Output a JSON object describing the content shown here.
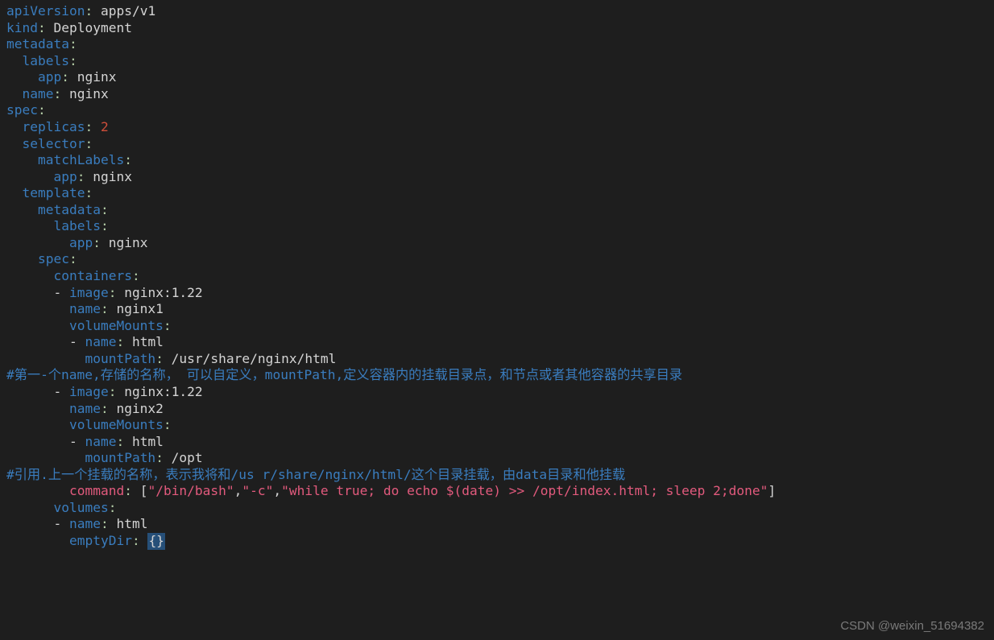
{
  "l1": {
    "k": "apiVersion",
    "c": ":",
    "v": " apps/v1"
  },
  "l2": {
    "k": "kind",
    "c": ":",
    "v": " Deployment"
  },
  "l3": {
    "k": "metadata",
    "c": ":"
  },
  "l4": {
    "k": "labels",
    "c": ":"
  },
  "l5": {
    "k": "app",
    "c": ":",
    "v": " nginx"
  },
  "l6": {
    "k": "name",
    "c": ":",
    "v": " nginx"
  },
  "l7": {
    "k": "spec",
    "c": ":"
  },
  "l8": {
    "k": "replicas",
    "c": ":",
    "sp": " ",
    "v": "2"
  },
  "l9": {
    "k": "selector",
    "c": ":"
  },
  "l10": {
    "k": "matchLabels",
    "c": ":"
  },
  "l11": {
    "k": "app",
    "c": ":",
    "v": " nginx"
  },
  "l12": {
    "k": "template",
    "c": ":"
  },
  "l13": {
    "k": "metadata",
    "c": ":"
  },
  "l14": {
    "k": "labels",
    "c": ":"
  },
  "l15": {
    "k": "app",
    "c": ":",
    "v": " nginx"
  },
  "l16": {
    "k": "spec",
    "c": ":"
  },
  "l17": {
    "k": "containers",
    "c": ":"
  },
  "l18": {
    "dash": "- ",
    "k": "image",
    "c": ":",
    "v": " nginx:1.22"
  },
  "l19": {
    "k": "name",
    "c": ":",
    "v": " nginx1"
  },
  "l20": {
    "k": "volumeMounts",
    "c": ":"
  },
  "l21": {
    "dash": "- ",
    "k": "name",
    "c": ":",
    "v": " html"
  },
  "l22": {
    "k": "mountPath",
    "c": ":",
    "v": " /usr/share/nginx/html"
  },
  "c1": "#第一-个name,存储的名称， 可以自定义，mountPath,定义容器内的挂载目录点，和节点或者其他容器的共享目录",
  "l23": {
    "dash": "- ",
    "k": "image",
    "c": ":",
    "v": " nginx:1.22"
  },
  "l24": {
    "k": "name",
    "c": ":",
    "v": " nginx2"
  },
  "l25": {
    "k": "volumeMounts",
    "c": ":"
  },
  "l26": {
    "dash": "- ",
    "k": "name",
    "c": ":",
    "v": " html"
  },
  "l27": {
    "k": "mountPath",
    "c": ":",
    "v": " /opt"
  },
  "c2": "#引用.上一个挂载的名称，表示我将和/us r/share/nginx/html/这个目录挂载，由data目录和他挂载",
  "l28": {
    "k": "command",
    "c": ":",
    "sp": " ",
    "b1": "[",
    "s1": "\"/bin/bash\"",
    "cm1": ",",
    "s2": "\"-c\"",
    "cm2": ",",
    "s3": "\"while true; do echo $(date) >> /opt/index.html; sleep 2;done\"",
    "b2": "]"
  },
  "l29": {
    "k": "volumes",
    "c": ":"
  },
  "l30": {
    "dash": "- ",
    "k": "name",
    "c": ":",
    "v": " html"
  },
  "l31": {
    "k": "emptyDir",
    "c": ":",
    "sp": " ",
    "cur": "{}"
  },
  "watermark": "CSDN @weixin_51694382"
}
